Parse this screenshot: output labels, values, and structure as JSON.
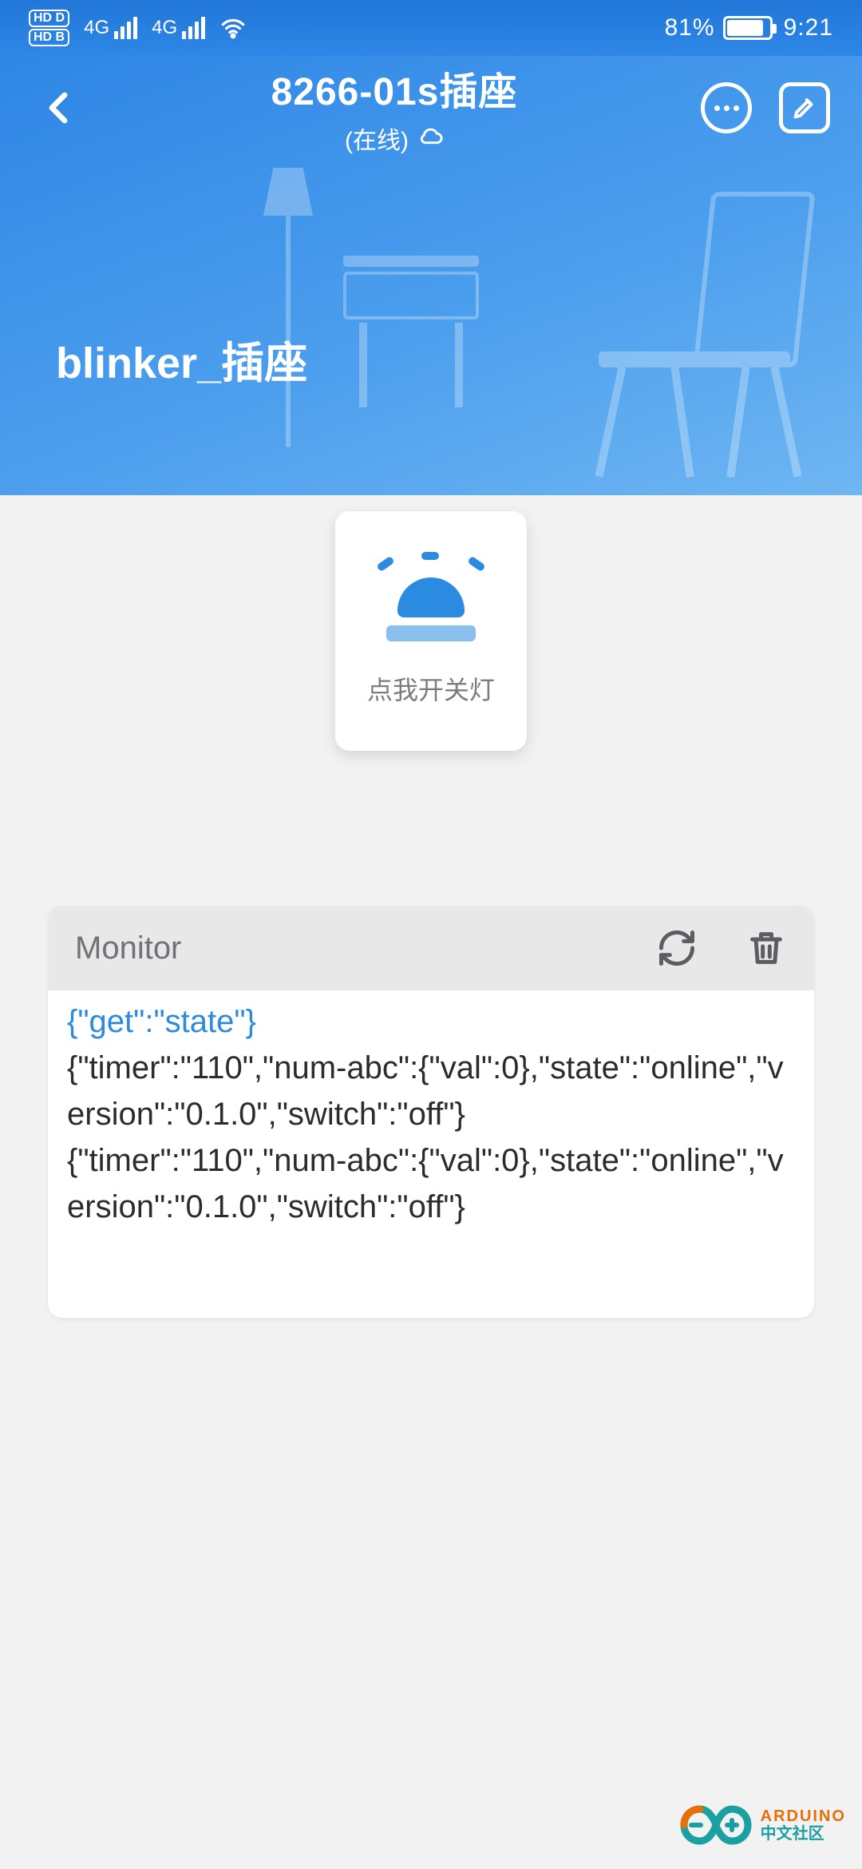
{
  "status_bar": {
    "hd_label_top": "HD D",
    "hd_label_bottom": "HD B",
    "net1_label": "4G",
    "net2_label": "4G",
    "battery_pct": "81%",
    "clock": "9:21"
  },
  "header": {
    "title": "8266-01s插座",
    "status_text": "(在线)",
    "device_name": "blinker_插座"
  },
  "toggle_card": {
    "label": "点我开关灯"
  },
  "monitor": {
    "title": "Monitor",
    "lines": [
      {
        "text": "{\"get\":\"state\"}",
        "highlight": true
      },
      {
        "text": "{\"timer\":\"110\",\"num-abc\":{\"val\":0},\"state\":\"online\",\"version\":\"0.1.0\",\"switch\":\"off\"}",
        "highlight": false
      },
      {
        "text": "{\"timer\":\"110\",\"num-abc\":{\"val\":0},\"state\":\"online\",\"version\":\"0.1.0\",\"switch\":\"off\"}",
        "highlight": false
      }
    ]
  },
  "watermark": {
    "brand": "ARDUINO",
    "subtitle": "中文社区"
  }
}
